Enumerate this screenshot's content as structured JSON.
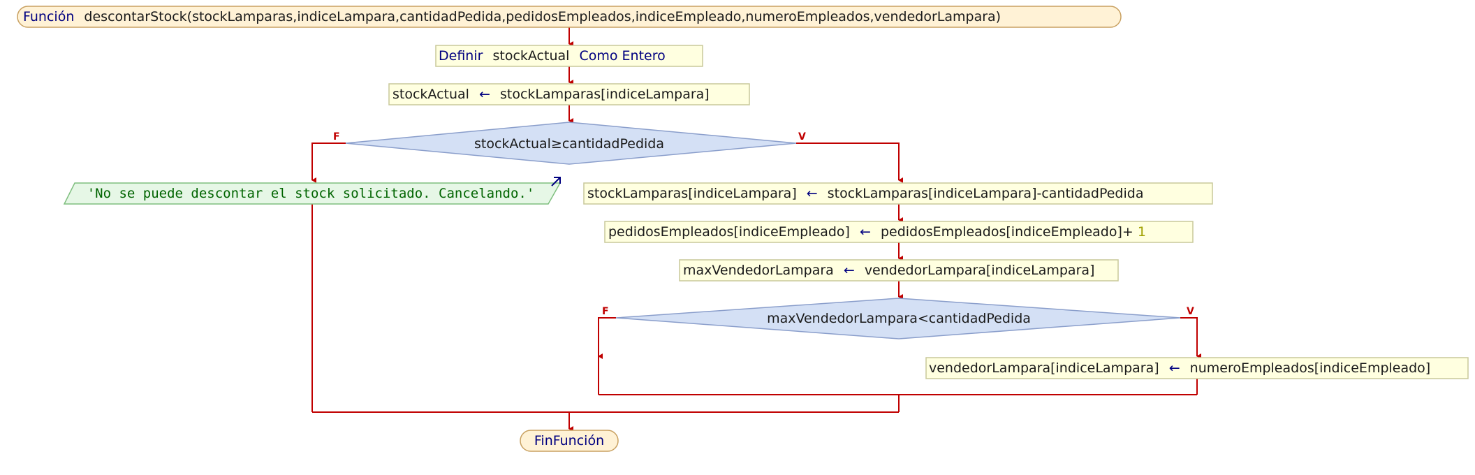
{
  "colors": {
    "flow": "#c00000",
    "keyword": "#000080",
    "text": "#1a1a1a",
    "string": "#006400",
    "process_fill": "#ffffe0",
    "process_stroke": "#c8c89a",
    "terminal_fill": "#fff2d6",
    "terminal_stroke": "#c8a060",
    "decision_fill": "#d4e0f5",
    "decision_stroke": "#8a9ecb",
    "output_fill": "#e6f7e6",
    "output_stroke": "#7fbf7f",
    "number": "#a0a000"
  },
  "start": {
    "keyword": "Función",
    "signature": "descontarStock(stockLamparas,indiceLampara,cantidadPedida,pedidosEmpleados,indiceEmpleado,numeroEmpleados,vendedorLampara)"
  },
  "define": {
    "kw1": "Definir",
    "var": "stockActual",
    "kw2": "Como Entero"
  },
  "assign1": {
    "lhs": "stockActual",
    "arrow": "←",
    "rhs": "stockLamparas[indiceLampara]"
  },
  "decision1": {
    "text": "stockActual≥cantidadPedida",
    "false_label": "F",
    "true_label": "V"
  },
  "output1": {
    "text": "'No se puede descontar el stock solicitado. Cancelando.'"
  },
  "assign2": {
    "lhs": "stockLamparas[indiceLampara]",
    "arrow": "←",
    "rhs": "stockLamparas[indiceLampara]-cantidadPedida"
  },
  "assign3": {
    "lhs": "pedidosEmpleados[indiceEmpleado]",
    "arrow": "←",
    "rhs": "pedidosEmpleados[indiceEmpleado]+",
    "num": "1"
  },
  "assign4": {
    "lhs": "maxVendedorLampara",
    "arrow": "←",
    "rhs": "vendedorLampara[indiceLampara]"
  },
  "decision2": {
    "text": "maxVendedorLampara<cantidadPedida",
    "false_label": "F",
    "true_label": "V"
  },
  "assign5": {
    "lhs": "vendedorLampara[indiceLampara]",
    "arrow": "←",
    "rhs": "numeroEmpleados[indiceEmpleado]"
  },
  "end": {
    "keyword": "FinFunción"
  }
}
